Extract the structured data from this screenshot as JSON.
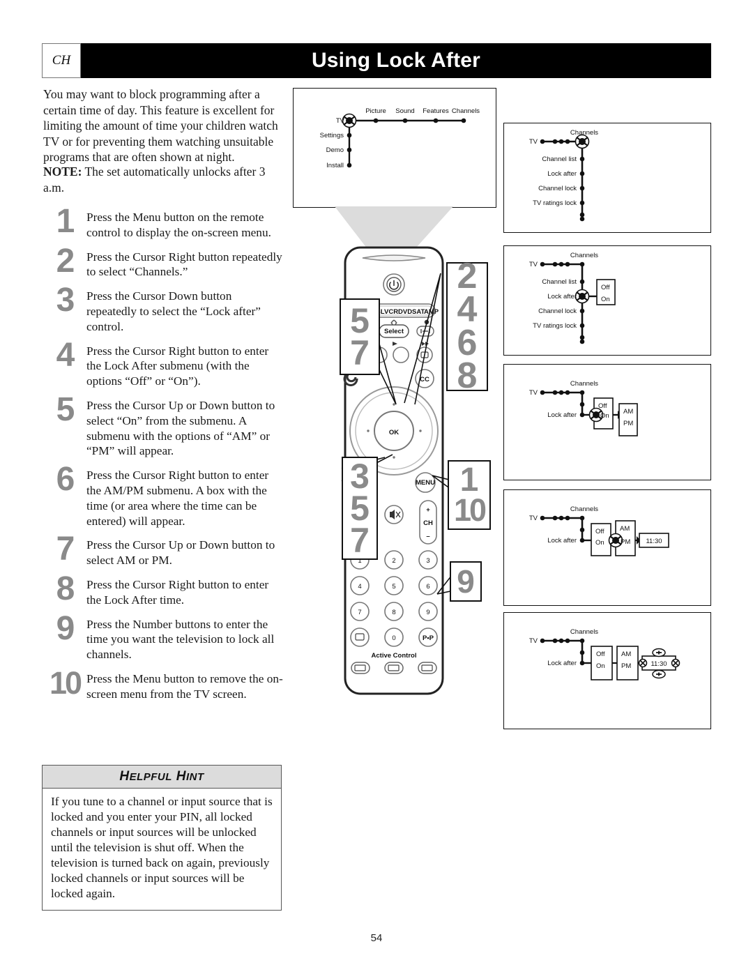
{
  "header": {
    "tab_label": "CH",
    "title": "Using Lock After"
  },
  "page_number": "54",
  "intro": "You may want to block programming after a certain time of day. This feature is excellent for limiting the amount of time your children watch TV or for preventing them watching unsuitable programs that are often shown at night.",
  "note": {
    "label": "NOTE:",
    "text": " The set automatically unlocks after 3 a.m."
  },
  "steps": [
    {
      "num": "1",
      "text": "Press the Menu button on the remote control to display the on-screen menu."
    },
    {
      "num": "2",
      "text": "Press the Cursor Right button repeatedly to select “Channels.”"
    },
    {
      "num": "3",
      "text": "Press the Cursor Down button repeatedly to select the “Lock after” control."
    },
    {
      "num": "4",
      "text": "Press the Cursor Right button to enter the Lock After submenu (with the options “Off” or “On”)."
    },
    {
      "num": "5",
      "text": "Press the Cursor Up or Down button to select “On” from the submenu. A submenu with the options of “AM” or “PM” will appear."
    },
    {
      "num": "6",
      "text": "Press the Cursor Right button to enter the AM/PM submenu. A box with the time (or area where the time can be entered) will appear."
    },
    {
      "num": "7",
      "text": "Press the Cursor Up or Down button to select AM or PM."
    },
    {
      "num": "8",
      "text": "Press the Cursor Right button to enter the Lock After time."
    },
    {
      "num": "9",
      "text": "Press the Number buttons to enter the time you want the television to lock all channels."
    },
    {
      "num": "10",
      "text": "Press the Menu button to remove the on-screen menu from the TV screen."
    }
  ],
  "hint": {
    "title_first": "H",
    "title_first_rest": "ELPFUL",
    "title_second": "H",
    "title_second_rest": "INT",
    "body": "If you tune to a channel or input source that is locked and you enter your PIN, all locked channels or input sources will be unlocked until the television is shut off. When the television is turned back on again, previously locked channels or input sources will be locked again."
  },
  "tv_screen_menu": {
    "root": "TV",
    "horizontal_items": [
      "Picture",
      "Sound",
      "Features",
      "Channels"
    ],
    "vertical_items": [
      "Settings",
      "Demo",
      "Install"
    ]
  },
  "panels": [
    {
      "id": "panel-channels-list",
      "root": "TV",
      "column_title": "Channels",
      "items": [
        "Channel list",
        "Lock after",
        "Channel lock",
        "TV ratings lock"
      ],
      "submenu": [],
      "submenu2": [],
      "time": null,
      "cursor_on": "Channels"
    },
    {
      "id": "panel-lock-after-options",
      "root": "TV",
      "column_title": "Channels",
      "items": [
        "Channel list",
        "Lock after",
        "Channel lock",
        "TV ratings lock"
      ],
      "submenu": [
        "Off",
        "On"
      ],
      "submenu2": [],
      "time": null,
      "cursor_on": "Lock after"
    },
    {
      "id": "panel-ampm-submenu",
      "root": "TV",
      "column_title": "Channels",
      "items": [
        "Lock after"
      ],
      "submenu": [
        "Off",
        "On"
      ],
      "submenu2": [
        "AM",
        "PM"
      ],
      "time": null,
      "cursor_on": "On"
    },
    {
      "id": "panel-time-box",
      "root": "TV",
      "column_title": "Channels",
      "items": [
        "Lock after"
      ],
      "submenu": [
        "Off",
        "On"
      ],
      "submenu2": [
        "AM",
        "PM"
      ],
      "time": "11:30",
      "cursor_on": "PM"
    },
    {
      "id": "panel-time-entry",
      "root": "TV",
      "column_title": "Channels",
      "items": [
        "Lock after"
      ],
      "submenu": [
        "Off",
        "On"
      ],
      "submenu2": [
        "AM",
        "PM"
      ],
      "time": "11:30",
      "cursor_on": "time"
    }
  ],
  "remote": {
    "device_row": [
      "TV",
      "CBL",
      "VCR",
      "DVD",
      "SAT",
      "AMP"
    ],
    "select_label": "Select",
    "cc_label": "CC",
    "ok_label": "OK",
    "menu_label": "MENU",
    "ch_label": "CH",
    "ch_plus": "+",
    "ch_minus": "–",
    "keypad": [
      "1",
      "2",
      "3",
      "4",
      "5",
      "6",
      "7",
      "8",
      "9",
      "0"
    ],
    "pip_label": "P•P",
    "active_control_label": "Active Control"
  },
  "callouts": [
    {
      "id": "callout-2468",
      "values": [
        "2",
        "4",
        "6",
        "8"
      ]
    },
    {
      "id": "callout-57",
      "values": [
        "5",
        "7"
      ]
    },
    {
      "id": "callout-357",
      "values": [
        "3",
        "5",
        "7"
      ]
    },
    {
      "id": "callout-110",
      "values": [
        "1",
        "10"
      ]
    },
    {
      "id": "callout-9",
      "values": [
        "9"
      ]
    }
  ]
}
